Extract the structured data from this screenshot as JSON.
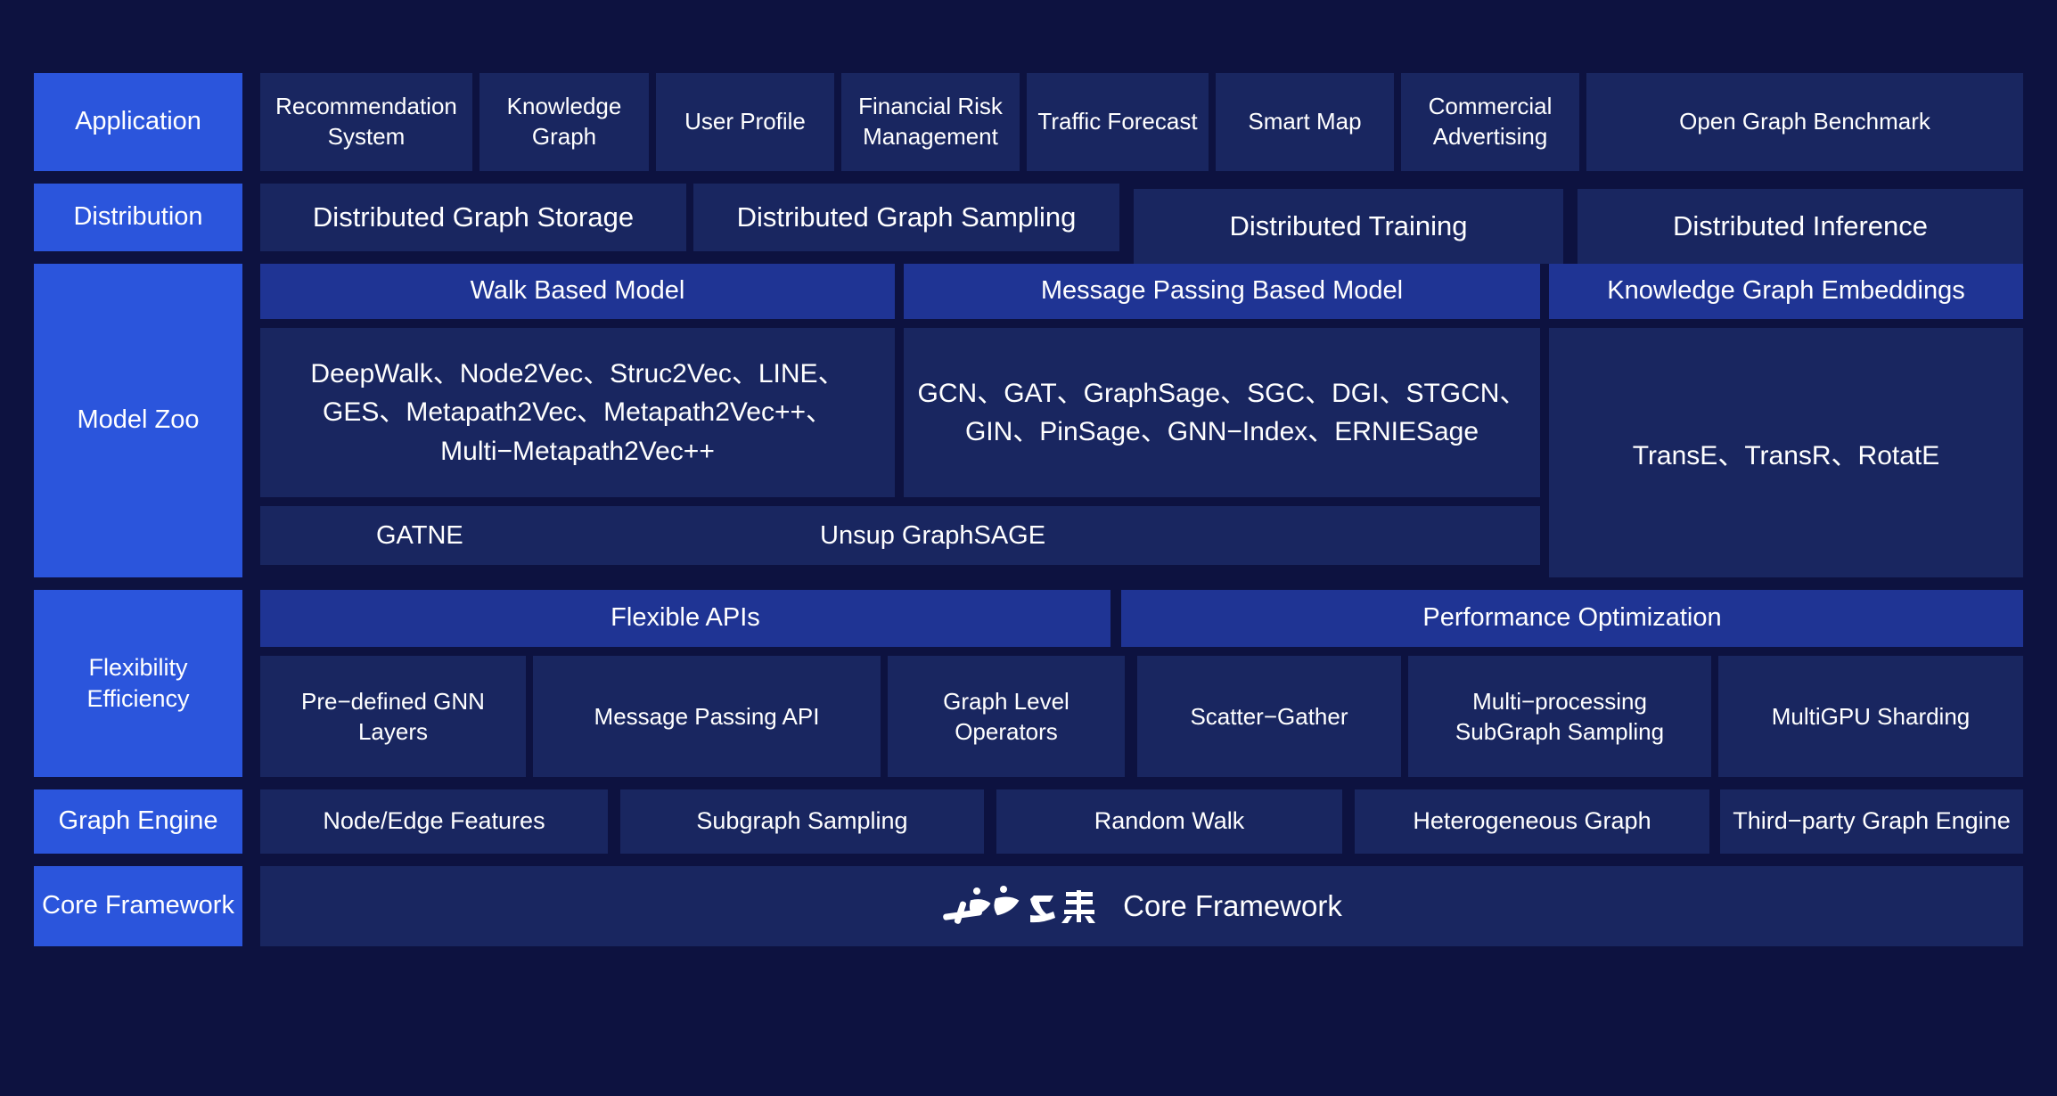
{
  "theme": {
    "page_background": "#0d1240",
    "accent_blue": "#2b55dc",
    "panel_blue": "#192660",
    "header_blue": "#1f3494",
    "text": "#ffffff"
  },
  "rows": {
    "application": {
      "label": "Application",
      "items": [
        "Recommendation System",
        "Knowledge Graph",
        "User Profile",
        "Financial Risk Management",
        "Traffic Forecast",
        "Smart Map",
        "Commercial Advertising",
        "Open Graph Benchmark"
      ]
    },
    "distribution": {
      "label": "Distribution",
      "items": [
        "Distributed Graph Storage",
        "Distributed Graph Sampling",
        "Distributed Training",
        "Distributed Inference"
      ]
    },
    "model_zoo": {
      "label": "Model Zoo",
      "columns": [
        {
          "header": "Walk Based Model",
          "body": "DeepWalk、Node2Vec、Struc2Vec、LINE、GES、Metapath2Vec、Metapath2Vec++、Multi−Metapath2Vec++"
        },
        {
          "header": "Message Passing Based Model",
          "body": "GCN、GAT、GraphSage、SGC、DGI、STGCN、GIN、PinSage、GNN−Index、ERNIESage"
        }
      ],
      "wide_items": [
        "GATNE",
        "Unsup GraphSAGE"
      ],
      "kge": {
        "header": "Knowledge Graph Embeddings",
        "body": "TransE、TransR、RotatE"
      }
    },
    "flexibility": {
      "label": "Flexibility Efficiency",
      "headers": [
        "Flexible APIs",
        "Performance Optimization"
      ],
      "items": [
        "Pre−defined GNN Layers",
        "Message Passing API",
        "Graph Level Operators",
        "Scatter−Gather",
        "Multi−processing SubGraph Sampling",
        "MultiGPU Sharding"
      ]
    },
    "graph_engine": {
      "label": "Graph Engine",
      "items": [
        "Node/Edge Features",
        "Subgraph Sampling",
        "Random Walk",
        "Heterogeneous Graph",
        "Third−party Graph Engine"
      ]
    },
    "core_framework": {
      "label": "Core Framework",
      "logo_name": "paddlepaddle-logo",
      "logo_text": "飞桨",
      "bar_text": "Core Framework"
    }
  }
}
